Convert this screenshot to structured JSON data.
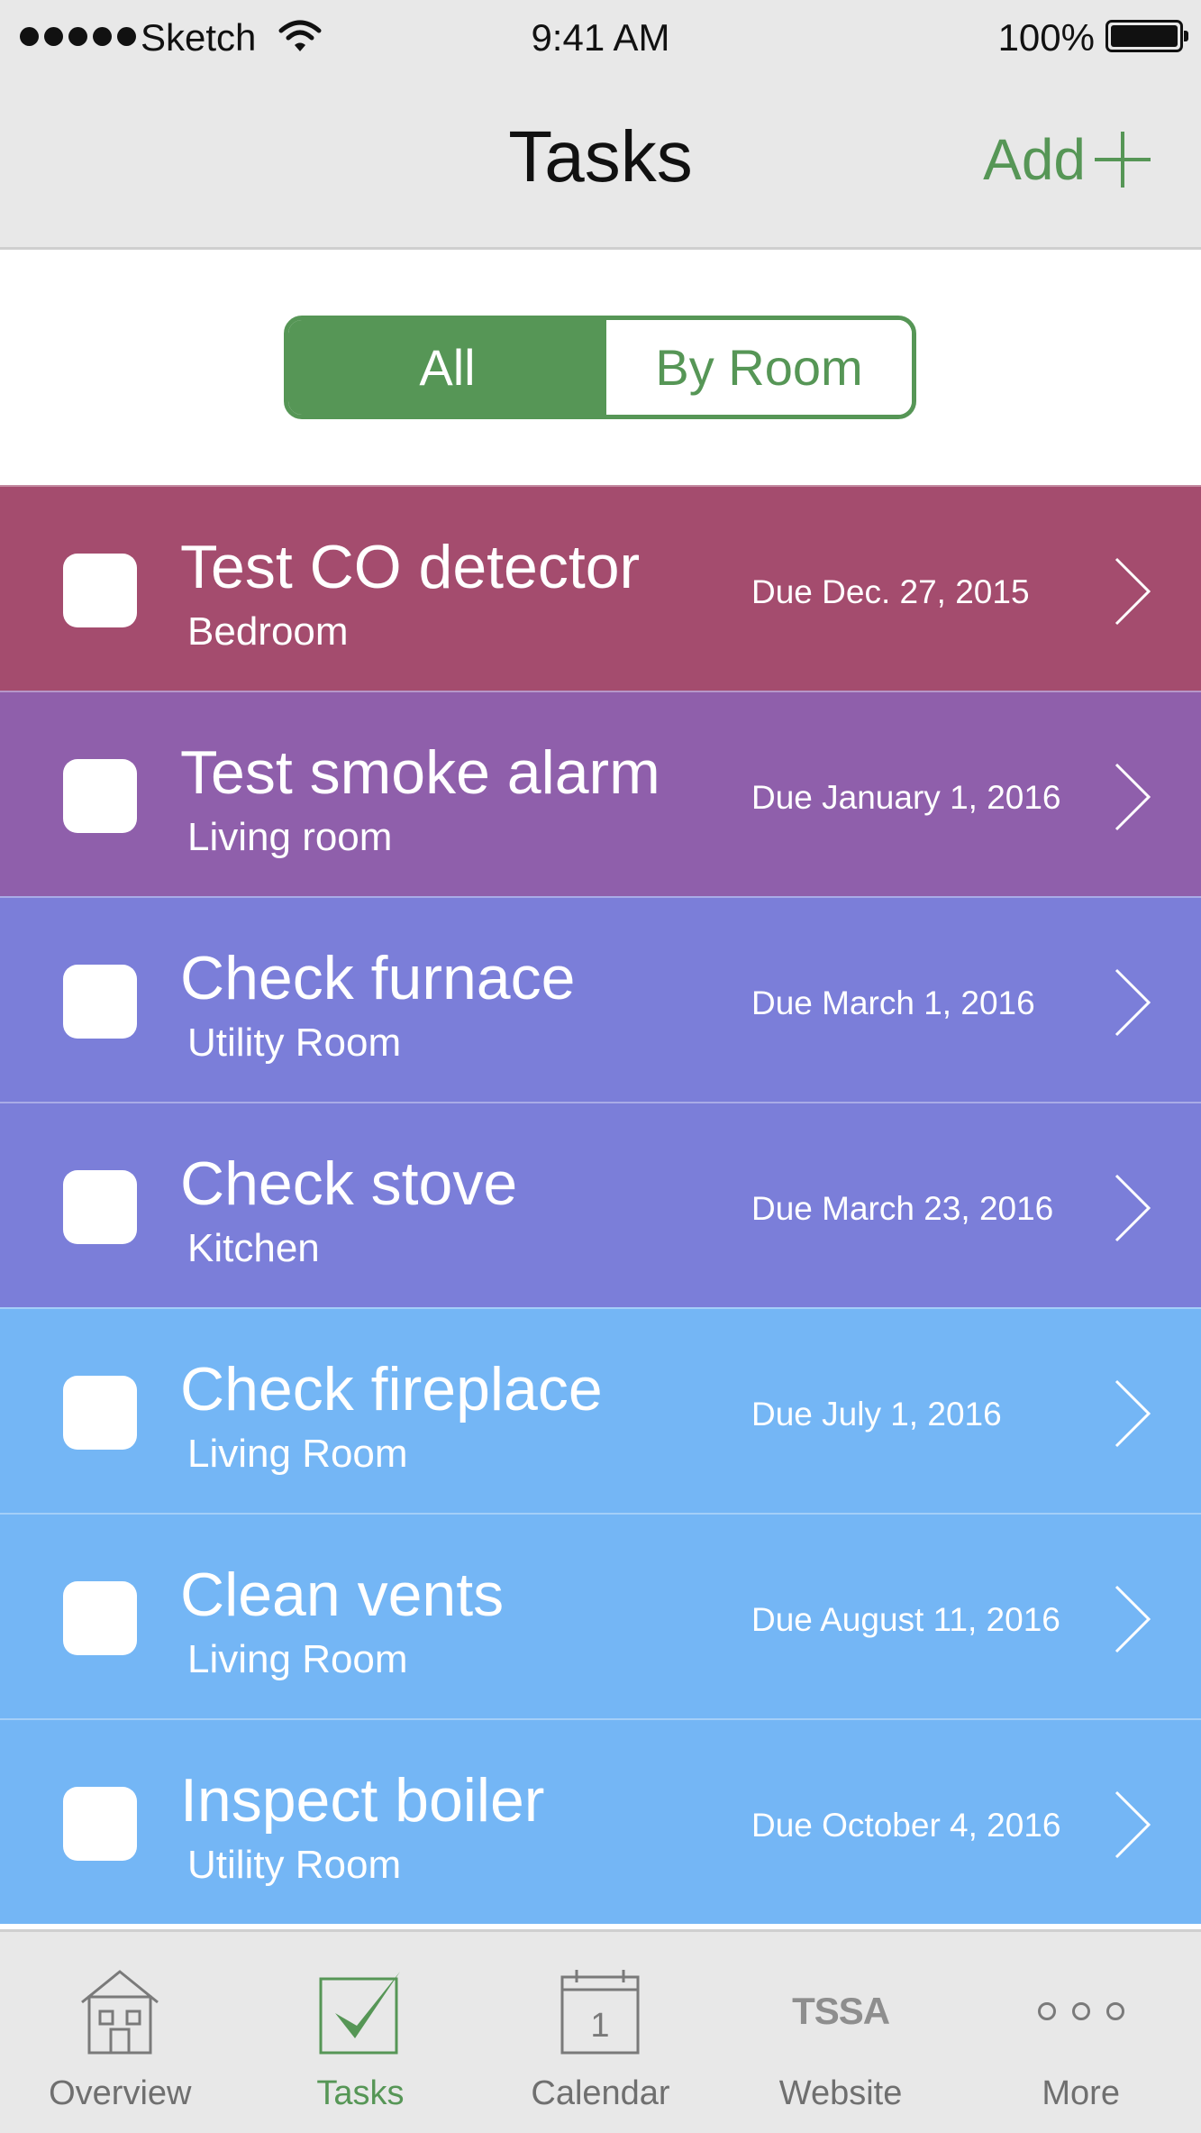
{
  "status_bar": {
    "carrier": "Sketch",
    "time": "9:41 AM",
    "battery": "100%"
  },
  "nav": {
    "title": "Tasks",
    "add_label": "Add"
  },
  "segment": {
    "all_label": "All",
    "by_room_label": "By Room",
    "selected": "All"
  },
  "tasks": [
    {
      "name": "Test CO detector",
      "room": "Bedroom",
      "due": "Due Dec. 27, 2015",
      "color": "#a44c6e"
    },
    {
      "name": "Test smoke alarm",
      "room": "Living room",
      "due": "Due January 1, 2016",
      "color": "#8f5fab"
    },
    {
      "name": "Check furnace",
      "room": "Utility Room",
      "due": "Due March 1, 2016",
      "color": "#7b7ed9"
    },
    {
      "name": "Check stove",
      "room": "Kitchen",
      "due": "Due March 23, 2016",
      "color": "#7b7ed9"
    },
    {
      "name": "Check fireplace",
      "room": "Living Room",
      "due": "Due July 1, 2016",
      "color": "#74b6f5"
    },
    {
      "name": "Clean vents",
      "room": "Living Room",
      "due": "Due August 11, 2016",
      "color": "#74b6f5"
    },
    {
      "name": "Inspect boiler",
      "room": "Utility Room",
      "due": "Due October 4, 2016",
      "color": "#74b6f5"
    }
  ],
  "tabbar": {
    "items": [
      {
        "label": "Overview",
        "icon": "house-icon"
      },
      {
        "label": "Tasks",
        "icon": "checkbox-checked-icon",
        "active": true
      },
      {
        "label": "Calendar",
        "icon": "calendar-icon",
        "day": "1"
      },
      {
        "label": "Website",
        "icon": "tssa-logo-icon",
        "logo_text": "TSSA"
      },
      {
        "label": "More",
        "icon": "more-dots-icon"
      }
    ]
  },
  "colors": {
    "accent_green": "#569656",
    "bar_gray": "#e8e8e8"
  }
}
